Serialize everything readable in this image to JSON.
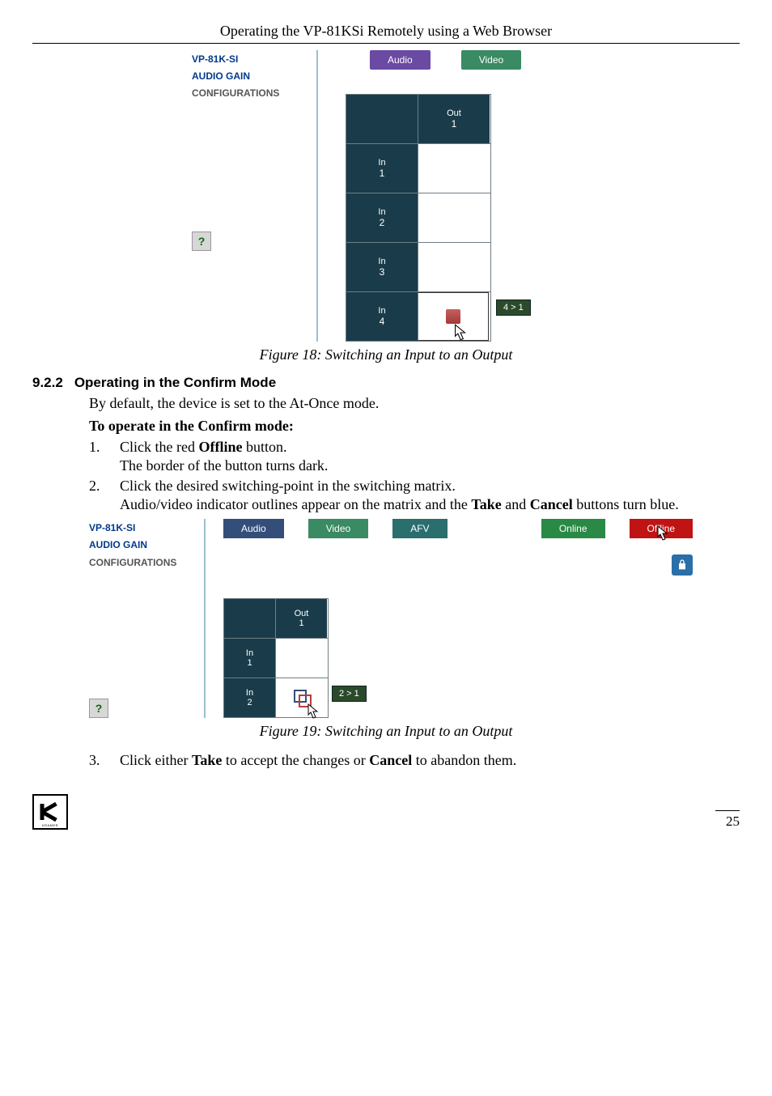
{
  "header": {
    "running_title": "Operating the VP-81KSi Remotely using a Web Browser"
  },
  "fig18": {
    "sidebar": {
      "line1": "VP-81K-SI",
      "line2": "AUDIO GAIN",
      "line3": "CONFIGURATIONS",
      "help": "?"
    },
    "tabs": {
      "audio": "Audio",
      "video": "Video"
    },
    "matrix": {
      "out_label": "Out",
      "out_num": "1",
      "in_label": "In",
      "in1": "1",
      "in2": "2",
      "in3": "3",
      "in4": "4"
    },
    "hover_tag": "4 > 1",
    "caption": "Figure 18: Switching an Input to an Output"
  },
  "section": {
    "num": "9.2.2",
    "title": "Operating in the Confirm Mode",
    "intro": "By default, the device is set to the At-Once mode.",
    "sub": "To operate in the Confirm mode:",
    "step1_idx": "1.",
    "step1_a": "Click the red ",
    "step1_b": "Offline",
    "step1_c": " button.",
    "step1_d": "The border of the button turns dark.",
    "step2_idx": "2.",
    "step2_a": "Click the desired switching-point in the switching matrix.",
    "step2_b_pre": "Audio/video indicator outlines appear on the matrix and the ",
    "step2_b_take": "Take",
    "step2_b_mid": " and ",
    "step2_b_cancel": "Cancel",
    "step2_b_post": " buttons turn blue.",
    "step3_idx": "3.",
    "step3_a": "Click either ",
    "step3_take": "Take",
    "step3_mid": " to accept the changes or ",
    "step3_cancel": "Cancel",
    "step3_end": " to abandon them."
  },
  "fig19": {
    "sidebar": {
      "line1": "VP-81K-SI",
      "line2": "AUDIO GAIN",
      "line3": "CONFIGURATIONS",
      "help": "?"
    },
    "tabs": {
      "audio": "Audio",
      "video": "Video",
      "afv": "AFV",
      "online": "Online",
      "offline": "Offline"
    },
    "matrix": {
      "out_label": "Out",
      "out_num": "1",
      "in_label": "In",
      "in1": "1",
      "in2": "2"
    },
    "hover_tag": "2 > 1",
    "caption": "Figure 19: Switching an Input to an Output"
  },
  "footer": {
    "page": "25",
    "brand": "KRAMER"
  }
}
